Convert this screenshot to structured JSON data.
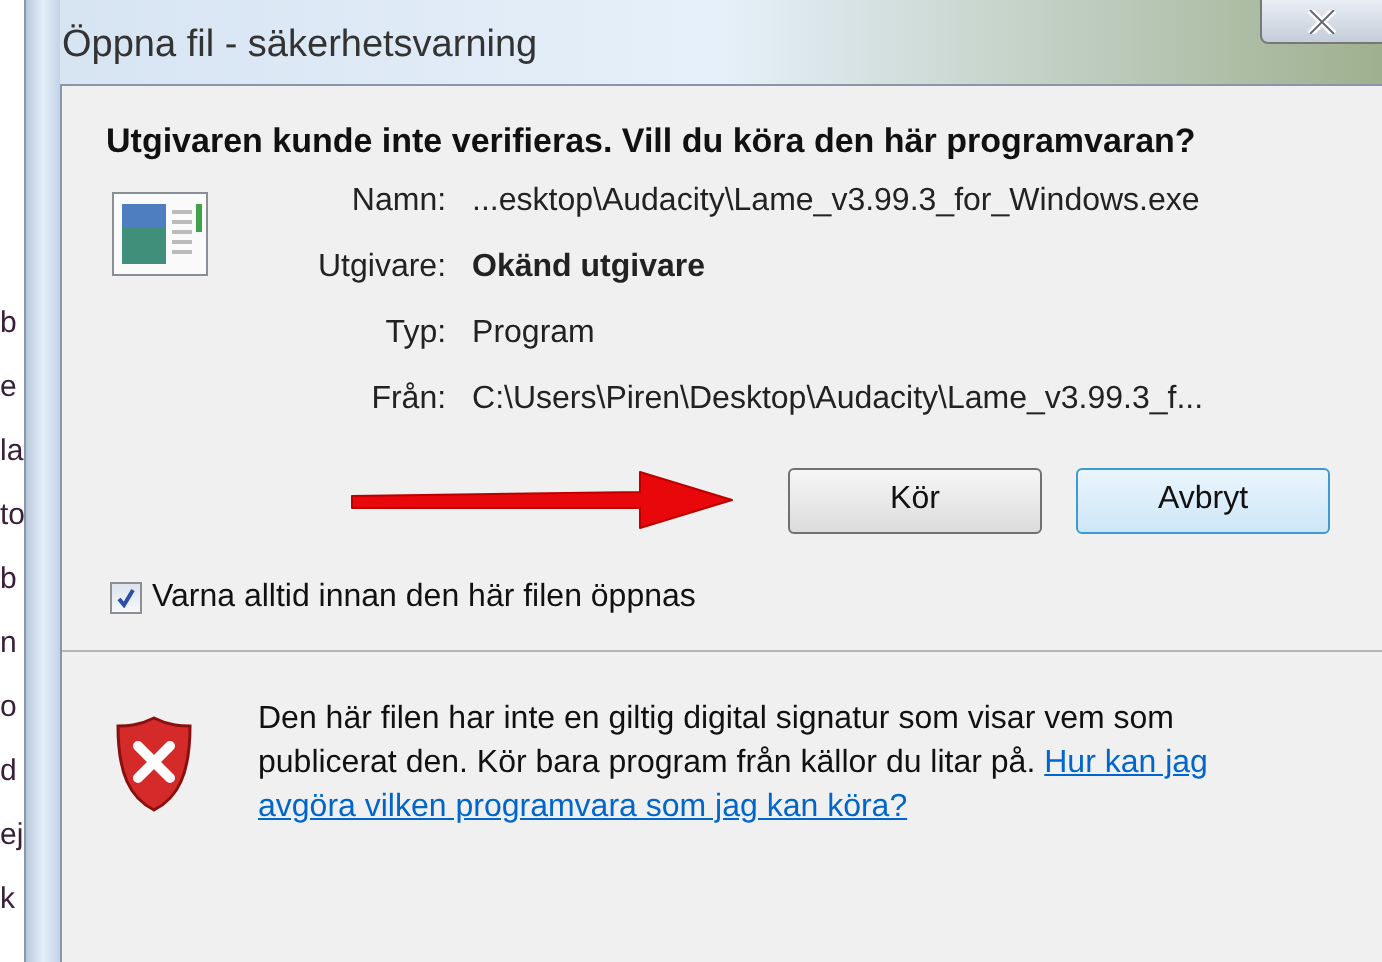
{
  "background_fragments": [
    "b",
    "e",
    "la",
    "to",
    "b",
    "n",
    "o",
    "d",
    "ej",
    "k"
  ],
  "window": {
    "title": "Öppna fil - säkerhetsvarning"
  },
  "heading": "Utgivaren kunde inte verifieras. Vill du köra den här programvaran?",
  "details": [
    {
      "label": "Namn:",
      "value": "...esktop\\Audacity\\Lame_v3.99.3_for_Windows.exe",
      "bold": false
    },
    {
      "label": "Utgivare:",
      "value": "Okänd utgivare",
      "bold": true
    },
    {
      "label": "Typ:",
      "value": "Program",
      "bold": false
    },
    {
      "label": "Från:",
      "value": "C:\\Users\\Piren\\Desktop\\Audacity\\Lame_v3.99.3_f...",
      "bold": false
    }
  ],
  "buttons": [
    {
      "label": "Kör",
      "focused": false
    },
    {
      "label": "Avbryt",
      "focused": true
    }
  ],
  "checkbox": {
    "label": "Varna alltid innan den här filen öppnas",
    "checked": true
  },
  "footer": {
    "text": "Den här filen har inte en giltig digital signatur som visar vem som publicerat den. Kör bara program från källor du litar på.",
    "link_lines": [
      "Hur kan jag",
      "avgöra vilken programvara som jag kan köra?"
    ]
  }
}
